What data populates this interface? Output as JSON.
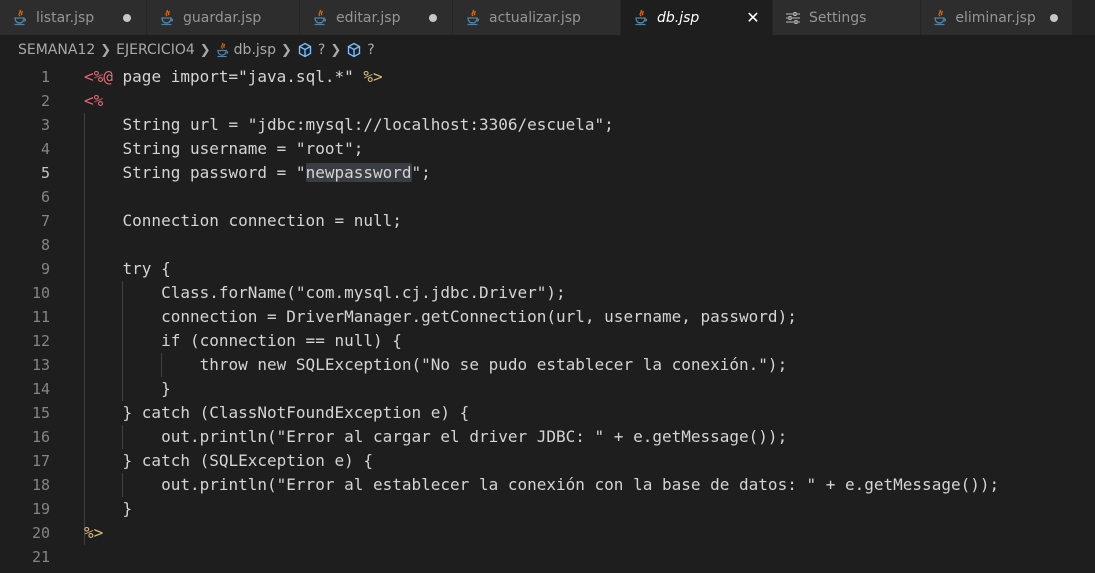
{
  "tabs": [
    {
      "label": "listar.jsp",
      "status": "dot",
      "active": false
    },
    {
      "label": "guardar.jsp",
      "status": "",
      "active": false
    },
    {
      "label": "editar.jsp",
      "status": "dot",
      "active": false
    },
    {
      "label": "actualizar.jsp",
      "status": "",
      "active": false
    },
    {
      "label": "db.jsp",
      "status": "close",
      "active": true
    },
    {
      "label": "Settings",
      "status": "",
      "active": false
    },
    {
      "label": "eliminar.jsp",
      "status": "dot",
      "active": false
    }
  ],
  "breadcrumb": {
    "folder1": "SEMANA12",
    "folder2": "EJERCICIO4",
    "file": "db.jsp",
    "symbol1": "?",
    "symbol2": "?"
  },
  "editor": {
    "current_line": 5,
    "lines": [
      {
        "n": "1",
        "text": "<%@ page import=\"java.sql.*\" %>"
      },
      {
        "n": "2",
        "text": "<%"
      },
      {
        "n": "3",
        "text": "    String url = \"jdbc:mysql://localhost:3306/escuela\";"
      },
      {
        "n": "4",
        "text": "    String username = \"root\";"
      },
      {
        "n": "5",
        "text": "    String password = \"newpassword\";"
      },
      {
        "n": "6",
        "text": ""
      },
      {
        "n": "7",
        "text": "    Connection connection = null;"
      },
      {
        "n": "8",
        "text": ""
      },
      {
        "n": "9",
        "text": "    try {"
      },
      {
        "n": "10",
        "text": "        Class.forName(\"com.mysql.cj.jdbc.Driver\");"
      },
      {
        "n": "11",
        "text": "        connection = DriverManager.getConnection(url, username, password);"
      },
      {
        "n": "12",
        "text": "        if (connection == null) {"
      },
      {
        "n": "13",
        "text": "            throw new SQLException(\"No se pudo establecer la conexión.\");"
      },
      {
        "n": "14",
        "text": "        }"
      },
      {
        "n": "15",
        "text": "    } catch (ClassNotFoundException e) {"
      },
      {
        "n": "16",
        "text": "        out.println(\"Error al cargar el driver JDBC: \" + e.getMessage());"
      },
      {
        "n": "17",
        "text": "    } catch (SQLException e) {"
      },
      {
        "n": "18",
        "text": "        out.println(\"Error al establecer la conexión con la base de datos: \" + e.getMessage());"
      },
      {
        "n": "19",
        "text": "    }"
      },
      {
        "n": "20",
        "text": "%>"
      },
      {
        "n": "21",
        "text": ""
      }
    ]
  },
  "colors": {
    "background": "#1e1e1e",
    "tab_bar": "#252526",
    "inactive_tab": "#2d2d2d",
    "text": "#d4d4d4",
    "line_number": "#858585",
    "selection_highlight": "#3a3d41"
  },
  "icons": {
    "file": "java-cup-icon",
    "settings": "settings-sliders-icon",
    "symbol": "cube-icon"
  }
}
